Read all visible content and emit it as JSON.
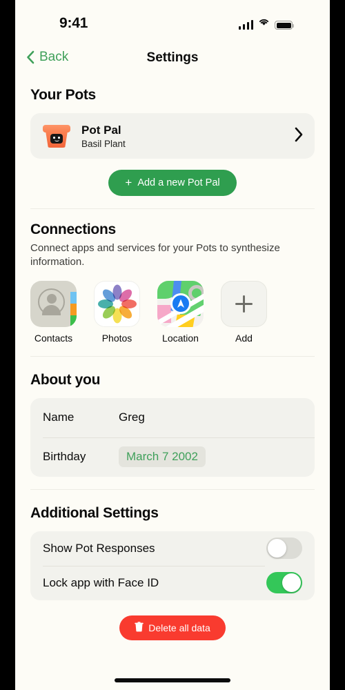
{
  "status_bar": {
    "time": "9:41",
    "signal_icon": "cellular-signal-icon",
    "wifi_icon": "wifi-icon",
    "battery_icon": "battery-full-icon"
  },
  "nav": {
    "back_label": "Back",
    "back_icon": "chevron-left-icon",
    "title": "Settings"
  },
  "your_pots": {
    "title": "Your Pots",
    "pot": {
      "name": "Pot Pal",
      "subtitle": "Basil Plant",
      "icon": "flower-pot-smiley-icon",
      "chevron_icon": "chevron-right-icon"
    },
    "add_button": {
      "label": "Add a new Pot Pal",
      "plus": "+"
    }
  },
  "connections": {
    "title": "Connections",
    "description": "Connect apps and services for your Pots to synthesize information.",
    "apps": [
      {
        "label": "Contacts",
        "icon": "contacts-app-icon"
      },
      {
        "label": "Photos",
        "icon": "photos-app-icon"
      },
      {
        "label": "Location",
        "icon": "maps-location-app-icon"
      },
      {
        "label": "Add",
        "icon": "plus-icon"
      }
    ]
  },
  "about_you": {
    "title": "About you",
    "rows": [
      {
        "key": "Name",
        "value": "Greg",
        "type": "text"
      },
      {
        "key": "Birthday",
        "value": "March 7 2002",
        "type": "date-pill"
      }
    ]
  },
  "additional_settings": {
    "title": "Additional Settings",
    "toggles": [
      {
        "label": "Show Pot Responses",
        "state": "off"
      },
      {
        "label": "Lock app with Face ID",
        "state": "on"
      }
    ]
  },
  "delete": {
    "label": "Delete all data",
    "icon": "trash-icon"
  },
  "colors": {
    "background": "#FDFCF6",
    "card": "#F2F2ED",
    "accent_green": "#2F9E4F",
    "link_green": "#3FA05A",
    "toggle_on": "#34C759",
    "danger_red": "#F93B2F",
    "pot_orange": "#FB8354"
  }
}
